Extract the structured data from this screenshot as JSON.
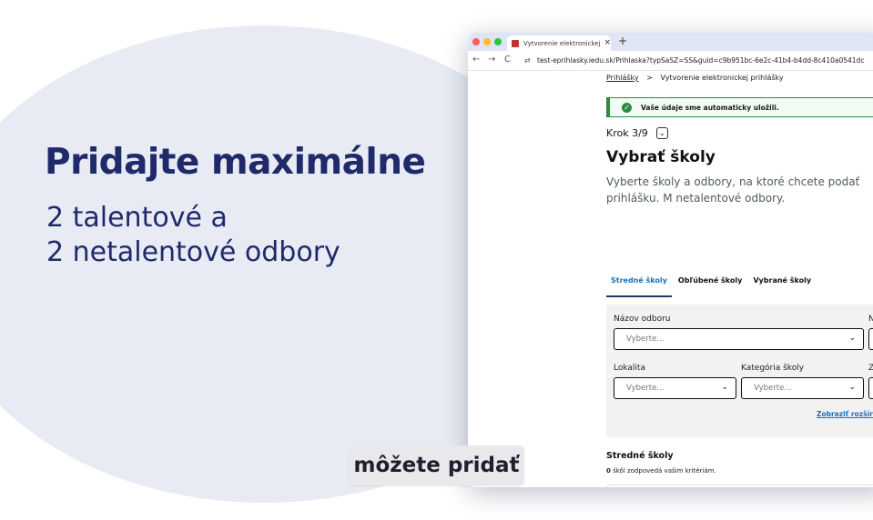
{
  "slide": {
    "headline": "Pridajte maximálne",
    "sub_line_1": "2 talentové a",
    "sub_line_2": "2 netalentové odbory",
    "caption": "môžete pridať"
  },
  "browser": {
    "tab_title": "Vytvorenie elektronickej prihl",
    "tab_close": "×",
    "new_tab": "+",
    "back": "←",
    "forward": "→",
    "reload": "C",
    "url_icon": "⇄",
    "url": "test-eprihlasky.iedu.sk/Prihlaska?typSaSZ=SS&guid=c9b951bc-6e2c-41b4-b4dd-8c410a0541dc"
  },
  "page": {
    "breadcrumb": [
      "Prihlášky",
      "Vytvorenie elektronickej prihlášky"
    ],
    "breadcrumb_separator": ">",
    "autosave_message": "Vaše údaje sme automaticky uložili.",
    "step_label": "Krok  3/9",
    "title": "Vybrať školy",
    "description": "Vyberte školy a odbory, na ktoré chcete podať prihlášku. M netalentové odbory.",
    "tabs": [
      {
        "label": "Stredné školy",
        "active": true
      },
      {
        "label": "Obľúbené školy",
        "active": false
      },
      {
        "label": "Vybrané školy",
        "active": false
      }
    ],
    "filters": {
      "field_label": "Názov odboru",
      "field_placeholder": "Vyberte...",
      "locality_label": "Lokalita",
      "locality_placeholder": "Vyberte...",
      "category_label": "Kategória školy",
      "category_placeholder": "Vyberte...",
      "right_label_1": "N",
      "right_label_2": "Z",
      "more_link": "Zobraziť rozšírené"
    },
    "results_title": "Stredné školy",
    "results_count_number": "0",
    "results_count_text": "škôl zodpovedá vašim kritériám."
  },
  "colors": {
    "headline": "#1f2a6b",
    "blob": "#e8ebf3",
    "success": "#2f8a3e",
    "link": "#1d70b8"
  },
  "icons": {
    "success": "check-circle-icon",
    "step_toggle": "chevron-down-icon",
    "select": "chevron-down-icon",
    "filter": "funnel-icon"
  }
}
